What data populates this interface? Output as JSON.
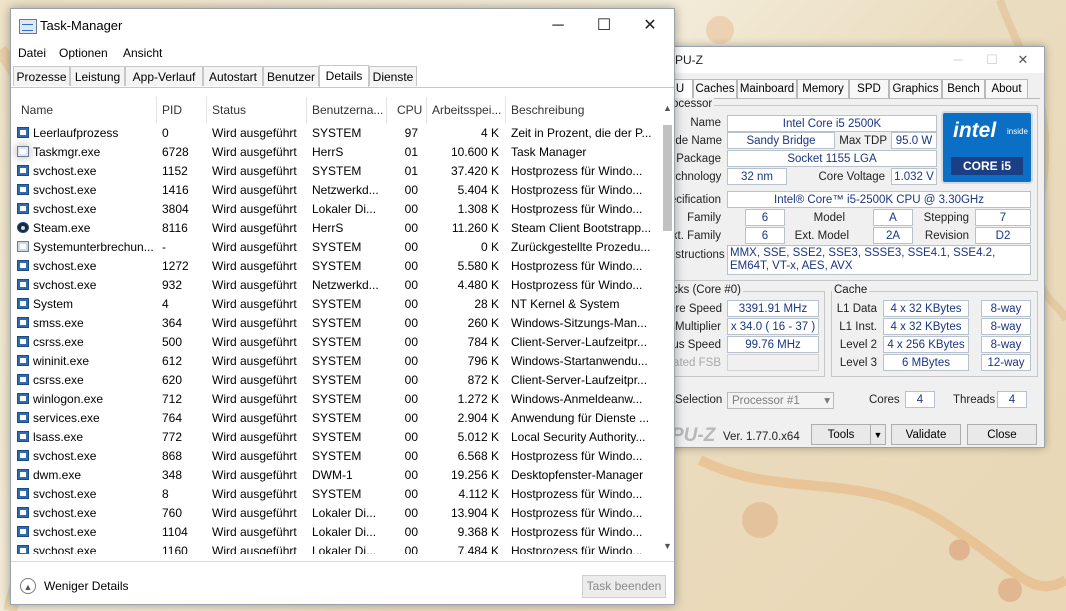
{
  "task_manager": {
    "title": "Task-Manager",
    "controls": {
      "minimize": "─",
      "maximize": "☐",
      "close": "✕"
    },
    "menu": [
      "Datei",
      "Optionen",
      "Ansicht"
    ],
    "tabs": [
      "Prozesse",
      "Leistung",
      "App-Verlauf",
      "Autostart",
      "Benutzer",
      "Details",
      "Dienste"
    ],
    "active_tab": "Details",
    "columns": [
      "Name",
      "PID",
      "Status",
      "Benutzerna...",
      "CPU",
      "Arbeitsspei...",
      "Beschreibung"
    ],
    "rows": [
      {
        "icon": "system-idle-icon",
        "name": "Leerlaufprozess",
        "pid": "0",
        "status": "Wird ausgeführt",
        "user": "SYSTEM",
        "cpu": "97",
        "mem": "4 K",
        "desc": "Zeit in Prozent, die der P..."
      },
      {
        "icon": "taskmgr-icon",
        "name": "Taskmgr.exe",
        "pid": "6728",
        "status": "Wird ausgeführt",
        "user": "HerrS",
        "cpu": "01",
        "mem": "10.600 K",
        "desc": "Task Manager"
      },
      {
        "icon": "service-host-icon",
        "name": "svchost.exe",
        "pid": "1152",
        "status": "Wird ausgeführt",
        "user": "SYSTEM",
        "cpu": "01",
        "mem": "37.420 K",
        "desc": "Hostprozess für Windo..."
      },
      {
        "icon": "service-host-icon",
        "name": "svchost.exe",
        "pid": "1416",
        "status": "Wird ausgeführt",
        "user": "Netzwerkd...",
        "cpu": "00",
        "mem": "5.404 K",
        "desc": "Hostprozess für Windo..."
      },
      {
        "icon": "service-host-icon",
        "name": "svchost.exe",
        "pid": "3804",
        "status": "Wird ausgeführt",
        "user": "Lokaler Di...",
        "cpu": "00",
        "mem": "1.308 K",
        "desc": "Hostprozess für Windo..."
      },
      {
        "icon": "steam-icon",
        "name": "Steam.exe",
        "pid": "8116",
        "status": "Wird ausgeführt",
        "user": "HerrS",
        "cpu": "00",
        "mem": "11.260 K",
        "desc": "Steam Client Bootstrapp..."
      },
      {
        "icon": "system-interrupts-icon",
        "name": "Systemunterbrechun...",
        "pid": "-",
        "status": "Wird ausgeführt",
        "user": "SYSTEM",
        "cpu": "00",
        "mem": "0 K",
        "desc": "Zurückgestellte Prozedu..."
      },
      {
        "icon": "service-host-icon",
        "name": "svchost.exe",
        "pid": "1272",
        "status": "Wird ausgeführt",
        "user": "SYSTEM",
        "cpu": "00",
        "mem": "5.580 K",
        "desc": "Hostprozess für Windo..."
      },
      {
        "icon": "service-host-icon",
        "name": "svchost.exe",
        "pid": "932",
        "status": "Wird ausgeführt",
        "user": "Netzwerkd...",
        "cpu": "00",
        "mem": "4.480 K",
        "desc": "Hostprozess für Windo..."
      },
      {
        "icon": "system-process-icon",
        "name": "System",
        "pid": "4",
        "status": "Wird ausgeführt",
        "user": "SYSTEM",
        "cpu": "00",
        "mem": "28 K",
        "desc": "NT Kernel & System"
      },
      {
        "icon": "process-icon",
        "name": "smss.exe",
        "pid": "364",
        "status": "Wird ausgeführt",
        "user": "SYSTEM",
        "cpu": "00",
        "mem": "260 K",
        "desc": "Windows-Sitzungs-Man..."
      },
      {
        "icon": "process-icon",
        "name": "csrss.exe",
        "pid": "500",
        "status": "Wird ausgeführt",
        "user": "SYSTEM",
        "cpu": "00",
        "mem": "784 K",
        "desc": "Client-Server-Laufzeitpr..."
      },
      {
        "icon": "process-icon",
        "name": "wininit.exe",
        "pid": "612",
        "status": "Wird ausgeführt",
        "user": "SYSTEM",
        "cpu": "00",
        "mem": "796 K",
        "desc": "Windows-Startanwendu..."
      },
      {
        "icon": "process-icon",
        "name": "csrss.exe",
        "pid": "620",
        "status": "Wird ausgeführt",
        "user": "SYSTEM",
        "cpu": "00",
        "mem": "872 K",
        "desc": "Client-Server-Laufzeitpr..."
      },
      {
        "icon": "process-icon",
        "name": "winlogon.exe",
        "pid": "712",
        "status": "Wird ausgeführt",
        "user": "SYSTEM",
        "cpu": "00",
        "mem": "1.272 K",
        "desc": "Windows-Anmeldeanw..."
      },
      {
        "icon": "process-icon",
        "name": "services.exe",
        "pid": "764",
        "status": "Wird ausgeführt",
        "user": "SYSTEM",
        "cpu": "00",
        "mem": "2.904 K",
        "desc": "Anwendung für Dienste ..."
      },
      {
        "icon": "process-icon",
        "name": "lsass.exe",
        "pid": "772",
        "status": "Wird ausgeführt",
        "user": "SYSTEM",
        "cpu": "00",
        "mem": "5.012 K",
        "desc": "Local Security Authority..."
      },
      {
        "icon": "service-host-icon",
        "name": "svchost.exe",
        "pid": "868",
        "status": "Wird ausgeführt",
        "user": "SYSTEM",
        "cpu": "00",
        "mem": "6.568 K",
        "desc": "Hostprozess für Windo..."
      },
      {
        "icon": "process-icon",
        "name": "dwm.exe",
        "pid": "348",
        "status": "Wird ausgeführt",
        "user": "DWM-1",
        "cpu": "00",
        "mem": "19.256 K",
        "desc": "Desktopfenster-Manager"
      },
      {
        "icon": "service-host-icon",
        "name": "svchost.exe",
        "pid": "8",
        "status": "Wird ausgeführt",
        "user": "SYSTEM",
        "cpu": "00",
        "mem": "4.112 K",
        "desc": "Hostprozess für Windo..."
      },
      {
        "icon": "service-host-icon",
        "name": "svchost.exe",
        "pid": "760",
        "status": "Wird ausgeführt",
        "user": "Lokaler Di...",
        "cpu": "00",
        "mem": "13.904 K",
        "desc": "Hostprozess für Windo..."
      },
      {
        "icon": "service-host-icon",
        "name": "svchost.exe",
        "pid": "1104",
        "status": "Wird ausgeführt",
        "user": "Lokaler Di...",
        "cpu": "00",
        "mem": "9.368 K",
        "desc": "Hostprozess für Windo..."
      },
      {
        "icon": "service-host-icon",
        "name": "svchost.exe",
        "pid": "1160",
        "status": "Wird ausgeführt",
        "user": "Lokaler Di...",
        "cpu": "00",
        "mem": "7.484 K",
        "desc": "Hostprozess für Windo..."
      }
    ],
    "footer": {
      "fewer_details": "Weniger Details",
      "end_task": "Task beenden"
    }
  },
  "cpuz": {
    "title": "PU-Z",
    "tabs": [
      "U",
      "Caches",
      "Mainboard",
      "Memory",
      "SPD",
      "Graphics",
      "Bench",
      "About"
    ],
    "processor": {
      "group": "ocessor",
      "name_label": "Name",
      "name": "Intel Core i5 2500K",
      "codename_label": "ode Name",
      "codename": "Sandy Bridge",
      "maxtdp_label": "Max TDP",
      "maxtdp": "95.0 W",
      "package_label": "Package",
      "package": "Socket 1155 LGA",
      "tech_label": "echnology",
      "tech": "32 nm",
      "voltage_label": "Core Voltage",
      "voltage": "1.032 V",
      "spec_label": "ecification",
      "spec": "Intel® Core™ i5-2500K CPU @ 3.30GHz",
      "family_label": "Family",
      "family": "6",
      "model_label": "Model",
      "model": "A",
      "stepping_label": "Stepping",
      "stepping": "7",
      "extfamily_label": "xt. Family",
      "extfamily": "6",
      "extmodel_label": "Ext. Model",
      "extmodel": "2A",
      "revision_label": "Revision",
      "revision": "D2",
      "instr_label": "nstructions",
      "instr": "MMX, SSE, SSE2, SSE3, SSSE3, SSE4.1, SSE4.2, EM64T, VT-x, AES, AVX"
    },
    "clocks": {
      "group": "cks (Core #0)",
      "corespeed_label": "ore Speed",
      "corespeed": "3391.91 MHz",
      "multiplier_label": "Multiplier",
      "multiplier": "x 34.0 ( 16 - 37 )",
      "busspeed_label": "us Speed",
      "busspeed": "99.76 MHz",
      "ratedfsb_label": "ated FSB"
    },
    "cache": {
      "group": "Cache",
      "rows": [
        {
          "label": "L1 Data",
          "size": "4 x 32 KBytes",
          "way": "8-way"
        },
        {
          "label": "L1 Inst.",
          "size": "4 x 32 KBytes",
          "way": "8-way"
        },
        {
          "label": "Level 2",
          "size": "4 x 256 KBytes",
          "way": "8-way"
        },
        {
          "label": "Level 3",
          "size": "6 MBytes",
          "way": "12-way"
        }
      ]
    },
    "selection_label": "Selection",
    "selection_value": "Processor #1",
    "cores_label": "Cores",
    "cores": "4",
    "threads_label": "Threads",
    "threads": "4",
    "brand": "PU-Z",
    "version": "Ver. 1.77.0.x64",
    "buttons": {
      "tools": "Tools",
      "tools_arrow": "▼",
      "validate": "Validate",
      "close": "Close"
    },
    "logo": {
      "word": "intel",
      "inside": "inside",
      "core": "CORE i5"
    }
  }
}
